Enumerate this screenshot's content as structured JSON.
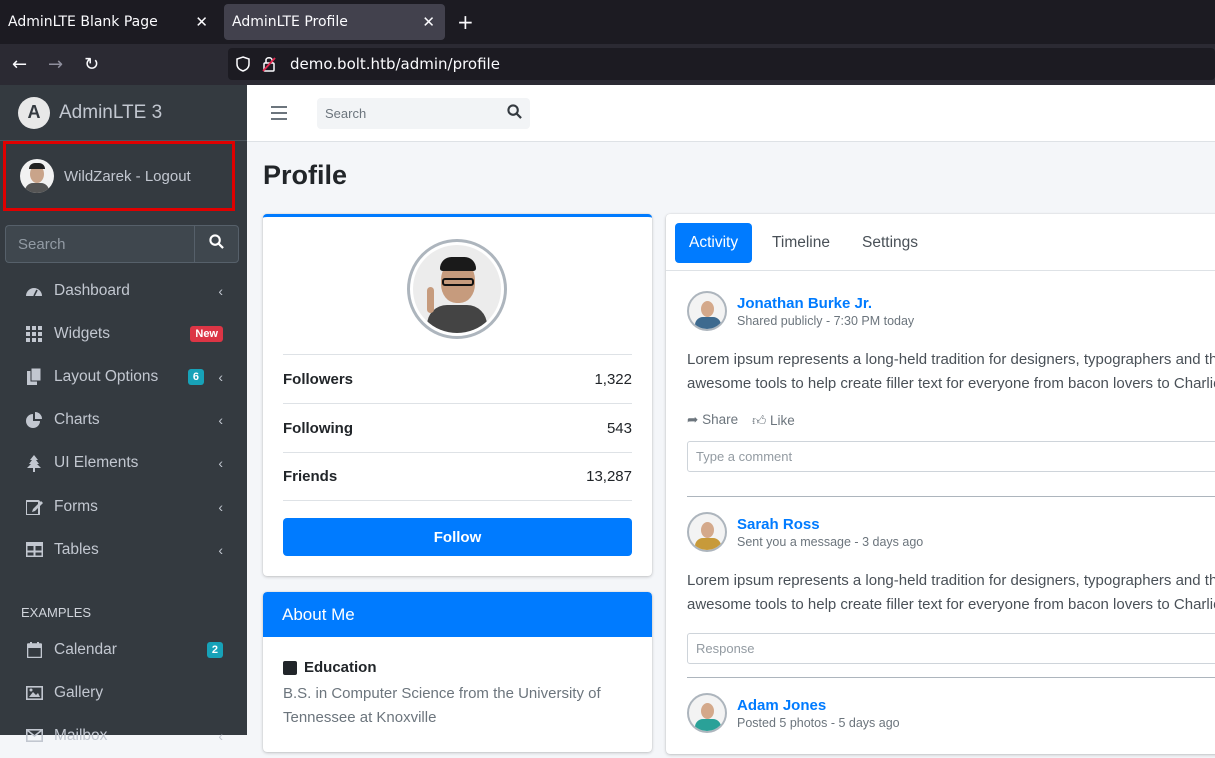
{
  "browser": {
    "tabs": [
      {
        "title": "AdminLTE Blank Page"
      },
      {
        "title": "AdminLTE Profile"
      }
    ],
    "url": "demo.bolt.htb/admin/profile"
  },
  "sidebar": {
    "brand": "AdminLTE 3",
    "user": "WildZarek - Logout",
    "search_placeholder": "Search",
    "items": [
      {
        "label": "Dashboard",
        "icon": "dashboard-icon"
      },
      {
        "label": "Widgets",
        "icon": "widgets-icon",
        "badge": "New"
      },
      {
        "label": "Layout Options",
        "icon": "copy-icon",
        "badge": "6"
      },
      {
        "label": "Charts",
        "icon": "pie-chart-icon"
      },
      {
        "label": "UI Elements",
        "icon": "tree-icon"
      },
      {
        "label": "Forms",
        "icon": "edit-icon"
      },
      {
        "label": "Tables",
        "icon": "table-icon"
      }
    ],
    "examples_header": "EXAMPLES",
    "examples": [
      {
        "label": "Calendar",
        "icon": "calendar-icon",
        "badge": "2"
      },
      {
        "label": "Gallery",
        "icon": "image-icon"
      },
      {
        "label": "Mailbox",
        "icon": "envelope-icon"
      }
    ]
  },
  "topbar": {
    "search_placeholder": "Search"
  },
  "page": {
    "title": "Profile"
  },
  "profile": {
    "stats": [
      {
        "label": "Followers",
        "value": "1,322"
      },
      {
        "label": "Following",
        "value": "543"
      },
      {
        "label": "Friends",
        "value": "13,287"
      }
    ],
    "follow_label": "Follow"
  },
  "about": {
    "title": "About Me",
    "education_title": "Education",
    "education_text": "B.S. in Computer Science from the University of Tennessee at Knoxville"
  },
  "activity": {
    "tabs": [
      "Activity",
      "Timeline",
      "Settings"
    ],
    "posts": [
      {
        "name": "Jonathan Burke Jr.",
        "meta": "Shared publicly - 7:30 PM today",
        "text1": "Lorem ipsum represents a long-held tradition for designers, typographers and th",
        "text2": "awesome tools to help create filler text for everyone from bacon lovers to Charlie",
        "share": "Share",
        "like": "Like",
        "input_placeholder": "Type a comment"
      },
      {
        "name": "Sarah Ross",
        "meta": "Sent you a message - 3 days ago",
        "text1": "Lorem ipsum represents a long-held tradition for designers, typographers and th",
        "text2": "awesome tools to help create filler text for everyone from bacon lovers to Charlie",
        "input_placeholder": "Response"
      },
      {
        "name": "Adam Jones",
        "meta": "Posted 5 photos - 5 days ago"
      }
    ]
  }
}
